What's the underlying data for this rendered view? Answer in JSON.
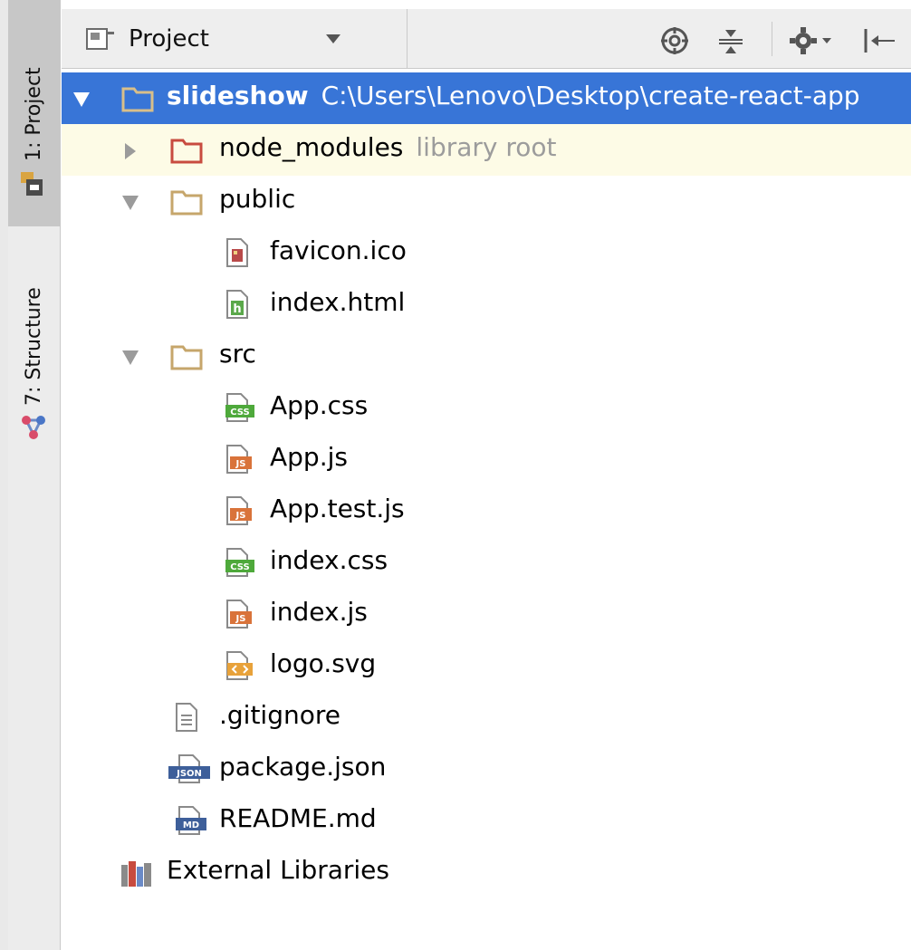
{
  "header": {
    "title": "Project",
    "icons": [
      "project-view-icon",
      "dropdown-icon",
      "locate-icon",
      "collapse-all-icon",
      "settings-icon",
      "hide-icon"
    ]
  },
  "strip": {
    "project_tab": "1: Project",
    "structure_tab": "7: Structure"
  },
  "tree": {
    "root": {
      "name": "slideshow",
      "path": "C:\\Users\\Lenovo\\Desktop\\create-react-app"
    },
    "node_modules": {
      "name": "node_modules",
      "note": "library root"
    },
    "public": {
      "name": "public"
    },
    "favicon": {
      "name": "favicon.ico"
    },
    "index_html": {
      "name": "index.html"
    },
    "src": {
      "name": "src"
    },
    "app_css": {
      "name": "App.css"
    },
    "app_js": {
      "name": "App.js"
    },
    "app_test_js": {
      "name": "App.test.js"
    },
    "index_css": {
      "name": "index.css"
    },
    "index_js": {
      "name": "index.js"
    },
    "logo_svg": {
      "name": "logo.svg"
    },
    "gitignore": {
      "name": ".gitignore"
    },
    "package_json": {
      "name": "package.json"
    },
    "readme": {
      "name": "README.md"
    },
    "external": {
      "name": "External Libraries"
    }
  },
  "icon_labels": {
    "css": "CSS",
    "js": "JS",
    "json": "JSON",
    "md": "MD",
    "html": "h"
  },
  "colors": {
    "selection": "#3875d7",
    "highlight_row": "#fdfbe6",
    "folder": "#c6a66b",
    "excluded_folder": "#c84b3f",
    "muted_text": "#9c9c9c"
  }
}
